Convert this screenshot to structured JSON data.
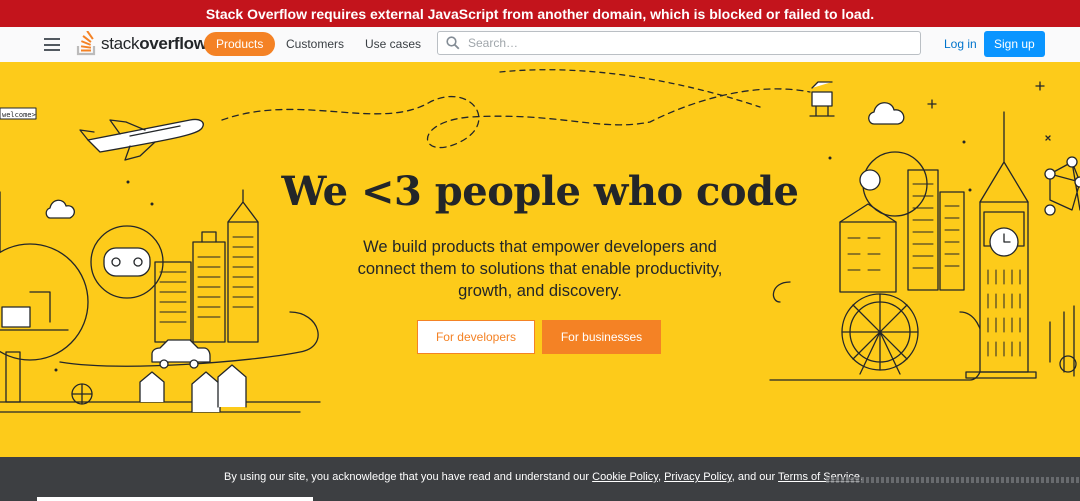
{
  "banner": {
    "text": "Stack Overflow requires external JavaScript from another domain, which is blocked or failed to load."
  },
  "topbar": {
    "logo": {
      "brand_light": "stack",
      "brand_bold": "overflow"
    },
    "nav": [
      {
        "label": "Products",
        "active": true
      },
      {
        "label": "Customers",
        "active": false
      },
      {
        "label": "Use cases",
        "active": false
      }
    ],
    "search": {
      "placeholder": "Search…",
      "value": ""
    },
    "login_label": "Log in",
    "signup_label": "Sign up"
  },
  "hero": {
    "headline": "We <3 people who code",
    "subtext": "We build products that empower developers and connect them to solutions that enable productivity, growth, and discovery.",
    "btn_developers": "For developers",
    "btn_businesses": "For businesses",
    "welcome_tag": "welcome>"
  },
  "cookie": {
    "prefix": "By using our site, you acknowledge that you have read and understand our ",
    "cookie_policy": "Cookie Policy",
    "sep1": ", ",
    "privacy_policy": "Privacy Policy",
    "sep2": ", and our ",
    "terms": "Terms of Service",
    "suffix": "."
  },
  "colors": {
    "banner_red": "#c3141c",
    "brand_orange": "#f48225",
    "hero_yellow": "#fdcb1a",
    "signup_blue": "#0a95ff",
    "cookie_bg": "#3d3f42"
  },
  "icons": [
    "menu-icon",
    "stackoverflow-logo-icon",
    "search-icon"
  ]
}
